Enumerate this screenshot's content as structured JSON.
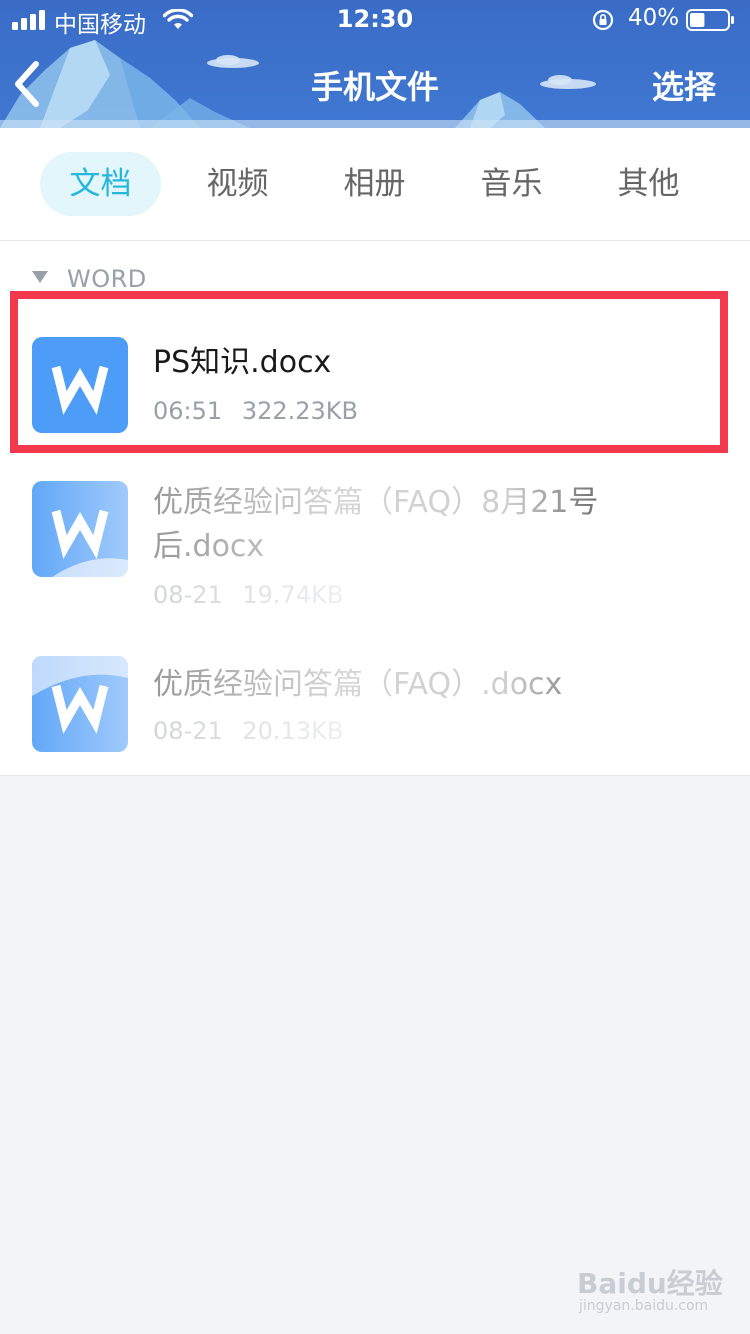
{
  "status_bar": {
    "carrier": "中国移动",
    "time": "12:30",
    "battery_percent": "40%",
    "battery_level": 0.4
  },
  "nav": {
    "title": "手机文件",
    "select_label": "选择",
    "back_icon": "chevron-left-icon"
  },
  "tabs": [
    {
      "label": "文档",
      "active": true
    },
    {
      "label": "视频",
      "active": false
    },
    {
      "label": "相册",
      "active": false
    },
    {
      "label": "音乐",
      "active": false
    },
    {
      "label": "其他",
      "active": false
    }
  ],
  "group": {
    "label": "WORD",
    "icon": "triangle-down-icon"
  },
  "files": [
    {
      "name": "PS知识.docx",
      "time": "06:51",
      "size": "322.23KB",
      "icon": "word-doc-icon",
      "highlighted": true
    },
    {
      "name": "优质经验问答篇（FAQ）8月21号后.docx",
      "time": "08-21",
      "size": "19.74KB",
      "icon": "word-doc-icon"
    },
    {
      "name": "优质经验问答篇（FAQ）.docx",
      "time": "08-21",
      "size": "20.13KB",
      "icon": "word-doc-icon"
    }
  ],
  "watermark": {
    "logo": "Baidu经验",
    "url": "jingyan.baidu.com"
  },
  "colors": {
    "header": "#3f78d2",
    "active_tab_text": "#27b6db",
    "active_tab_bg": "#e3f6fb",
    "file_icon": "#4d9cf7",
    "highlight": "#f2394e"
  }
}
